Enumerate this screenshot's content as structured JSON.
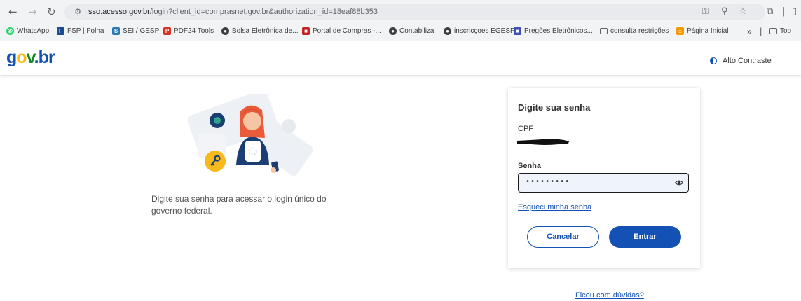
{
  "browser": {
    "url_host": "sso.acesso.gov.br",
    "url_rest": "/login?client_id=comprasnet.gov.br&authorization_id=18eaf88b353",
    "bookmarks": [
      {
        "label": "WhatsApp",
        "icon": "whatsapp-icon",
        "color": "#25d366"
      },
      {
        "label": "FSP | Folha",
        "icon": "folha-icon",
        "color": "#1a4d8f"
      },
      {
        "label": "SEI / GESP",
        "icon": "sei-icon",
        "color": "#2a7ab5"
      },
      {
        "label": "PDF24 Tools",
        "icon": "pdf24-icon",
        "color": "#d93025"
      },
      {
        "label": "Bolsa Eletrônica de...",
        "icon": "globe-icon",
        "color": "#3c4043"
      },
      {
        "label": "Portal de Compras -...",
        "icon": "portal-icon",
        "color": "#c5221f"
      },
      {
        "label": "Contabiliza",
        "icon": "globe-icon",
        "color": "#3c4043"
      },
      {
        "label": "inscricçoes EGESP",
        "icon": "globe-icon",
        "color": "#3c4043"
      },
      {
        "label": "Pregões Eletrônicos...",
        "icon": "pregoes-icon",
        "color": "#3f51b5"
      },
      {
        "label": "consulta restrições",
        "icon": "folder-icon",
        "color": "#5f6368"
      },
      {
        "label": "Página Inicial",
        "icon": "home-page-icon",
        "color": "#f29900"
      },
      {
        "label": "Too",
        "icon": "folder-icon",
        "color": "#5f6368"
      }
    ],
    "more_label": "»"
  },
  "header": {
    "logo_g": "g",
    "logo_o": "o",
    "logo_v": "v",
    "logo_br": ".br",
    "contrast_label": "Alto Contraste"
  },
  "main": {
    "description": "Digite sua senha para acessar o login único do governo federal."
  },
  "login_card": {
    "title": "Digite sua senha",
    "cpf_label": "CPF",
    "password_label": "Senha",
    "password_value": "•••••••••",
    "forgot_link": "Esqueci minha senha",
    "cancel_label": "Cancelar",
    "enter_label": "Entrar"
  },
  "footer": {
    "help_link": "Ficou com dúvidas?"
  },
  "colors": {
    "primary_blue": "#1351b4",
    "logo_yellow": "#f8b91c",
    "logo_green": "#168821"
  }
}
